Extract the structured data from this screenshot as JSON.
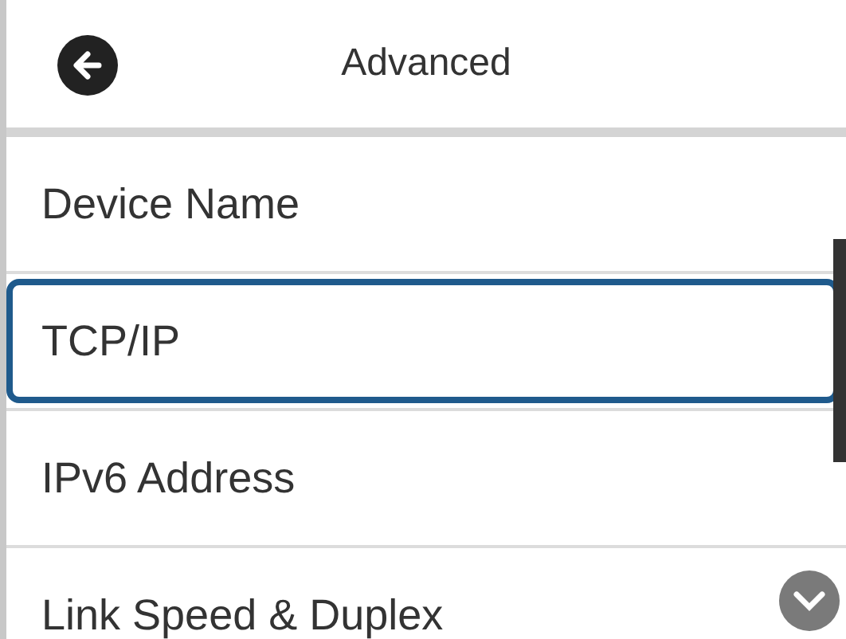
{
  "header": {
    "title": "Advanced"
  },
  "items": [
    {
      "label": "Device Name",
      "selected": false
    },
    {
      "label": "TCP/IP",
      "selected": true
    },
    {
      "label": "IPv6 Address",
      "selected": false
    },
    {
      "label": "Link Speed & Duplex",
      "selected": false
    }
  ]
}
